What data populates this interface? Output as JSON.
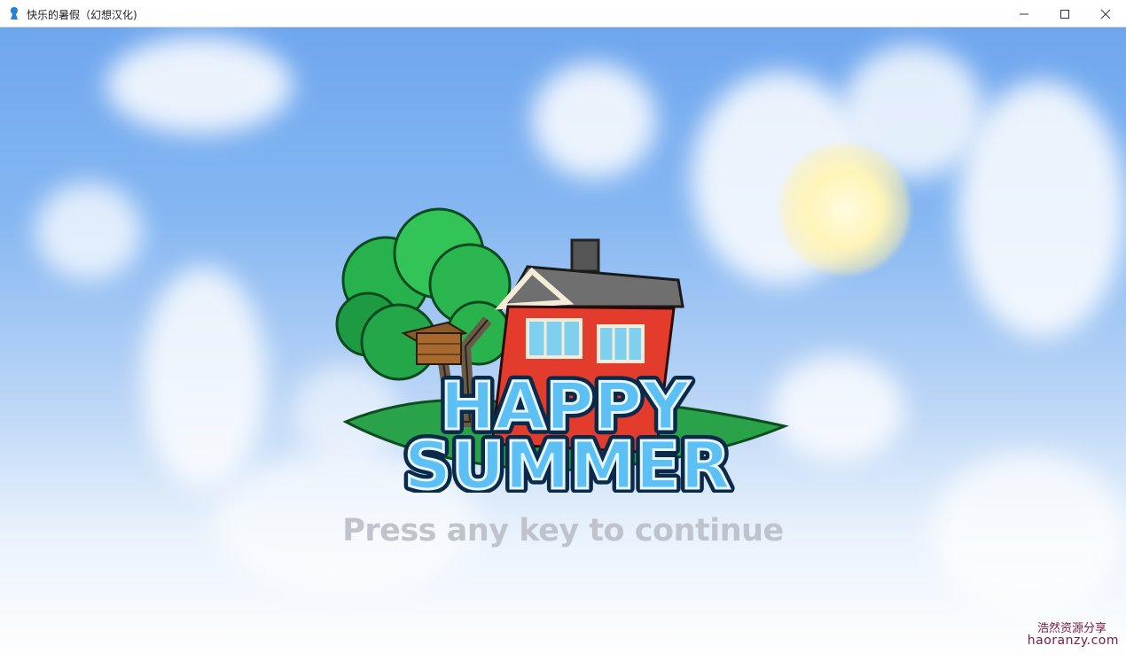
{
  "window": {
    "title": "快乐的暑假（幻想汉化)",
    "icons": [
      "app-icon",
      "minimize-icon",
      "maximize-icon",
      "close-icon"
    ]
  },
  "game": {
    "logo_line1": "HAPPY",
    "logo_line2": "SUMMER",
    "prompt": "Press any key to continue"
  },
  "watermark": {
    "line1": "浩然资源分享",
    "line2": "haoranzy.com"
  },
  "colors": {
    "sky_top": "#6ea6ee",
    "sky_bottom": "#ffffff",
    "logo_letters": "#5cc0f5",
    "house": "#e33b2c",
    "tree": "#1fa84a",
    "watermark": "#7a1a44"
  }
}
